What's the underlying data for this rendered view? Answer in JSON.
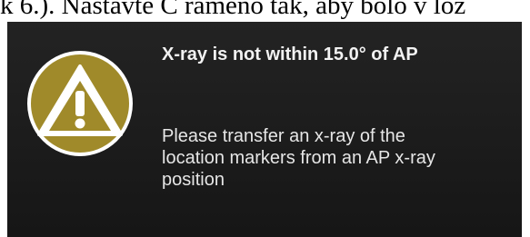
{
  "background_text": "k 6.). Nastavte C rameno tak, aby bolo v lož",
  "dialog": {
    "icon": "warning-triangle-icon",
    "title": "X-ray is not within 15.0° of AP",
    "message_lines": [
      "Please transfer an x-ray of the",
      "location markers from an AP x-ray",
      "position"
    ]
  },
  "colors": {
    "dialog_background": "#1c1c1c",
    "icon_gold": "#a08a2a",
    "icon_ring": "#ffffff",
    "text": "#f2f2f2"
  }
}
